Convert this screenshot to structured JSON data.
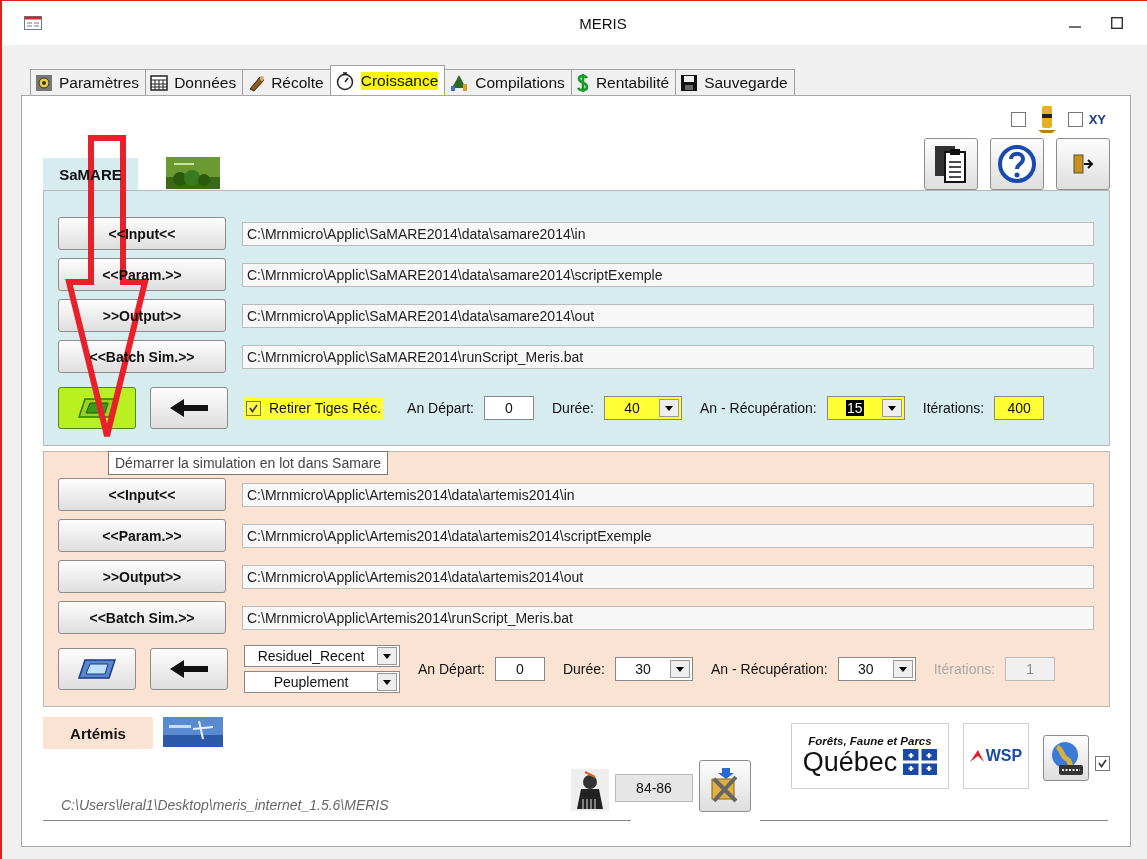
{
  "window": {
    "title": "MERIS"
  },
  "tabs": [
    {
      "label": "Paramètres",
      "selected": false,
      "highlighted": false
    },
    {
      "label": "Données",
      "selected": false,
      "highlighted": false
    },
    {
      "label": "Récolte",
      "selected": false,
      "highlighted": false
    },
    {
      "label": "Croissance",
      "selected": true,
      "highlighted": true
    },
    {
      "label": "Compilations",
      "selected": false,
      "highlighted": false
    },
    {
      "label": "Rentabilité",
      "selected": false,
      "highlighted": false
    },
    {
      "label": "Sauvegarde",
      "selected": false,
      "highlighted": false
    }
  ],
  "top_options": [
    {
      "kind": "icon_toggle",
      "checked": false
    },
    {
      "kind": "text_toggle",
      "label": "XY",
      "checked": false
    }
  ],
  "sections": [
    {
      "kind": "samare",
      "title": "SaMARE",
      "run_highlighted": true,
      "paths": [
        {
          "button": "<<Input<<",
          "path": "C:\\Mrnmicro\\Applic\\SaMARE2014\\data\\samare2014\\in"
        },
        {
          "button": "<<Param.>>",
          "path": "C:\\Mrnmicro\\Applic\\SaMARE2014\\data\\samare2014\\scriptExemple"
        },
        {
          "button": ">>Output>>",
          "path": "C:\\Mrnmicro\\Applic\\SaMARE2014\\data\\samare2014\\out"
        },
        {
          "button": "<<Batch Sim.>>",
          "path": "C:\\Mrnmicro\\Applic\\SaMARE2014\\runScript_Meris.bat"
        }
      ],
      "options": [
        {
          "kind": "checkbox",
          "label": "Retirer Tiges Réc.",
          "checked": true,
          "highlighted": true
        },
        {
          "kind": "input",
          "label": "An Départ:",
          "value": "0",
          "highlighted": false,
          "disabled": false
        },
        {
          "kind": "combo",
          "label": "Durée:",
          "value": "40",
          "highlighted": true,
          "text_selected": false
        },
        {
          "kind": "combo",
          "label": "An - Récupération:",
          "value": "15",
          "highlighted": true,
          "text_selected": true
        },
        {
          "kind": "input",
          "label": "Itérations:",
          "value": "400",
          "highlighted": true,
          "disabled": false
        }
      ]
    },
    {
      "kind": "artemis",
      "title": "Artémis",
      "run_highlighted": false,
      "paths": [
        {
          "button": "<<Input<<",
          "path": "C:\\Mrnmicro\\Applic\\Artemis2014\\data\\artemis2014\\in"
        },
        {
          "button": "<<Param.>>",
          "path": "C:\\Mrnmicro\\Applic\\Artemis2014\\data\\artemis2014\\scriptExemple"
        },
        {
          "button": ">>Output>>",
          "path": "C:\\Mrnmicro\\Applic\\Artemis2014\\data\\artemis2014\\out"
        },
        {
          "button": "<<Batch Sim.>>",
          "path": "C:\\Mrnmicro\\Applic\\Artemis2014\\runScript_Meris.bat"
        }
      ],
      "options": [
        {
          "kind": "combo_stack",
          "values": [
            "Residuel_Recent",
            "Peuplement"
          ]
        },
        {
          "kind": "input",
          "label": "An Départ:",
          "value": "0",
          "highlighted": false,
          "disabled": false
        },
        {
          "kind": "combo",
          "label": "Durée:",
          "value": "30",
          "highlighted": false,
          "text_selected": false
        },
        {
          "kind": "combo",
          "label": "An - Récupération:",
          "value": "30",
          "highlighted": false,
          "text_selected": false
        },
        {
          "kind": "input",
          "label": "Itérations:",
          "value": "1",
          "highlighted": false,
          "disabled": true
        }
      ]
    }
  ],
  "tooltip": "Démarrer la simulation en lot dans Samare",
  "footer": {
    "code": "84-86",
    "path": "C:\\Users\\leral1\\Desktop\\meris_internet_1.5.6\\MERIS",
    "logo_lines": [
      "Forêts, Faune et Parcs",
      "Québec"
    ],
    "partner": "WSP",
    "web_checked": true
  },
  "annotation": {
    "kind": "arrow"
  }
}
